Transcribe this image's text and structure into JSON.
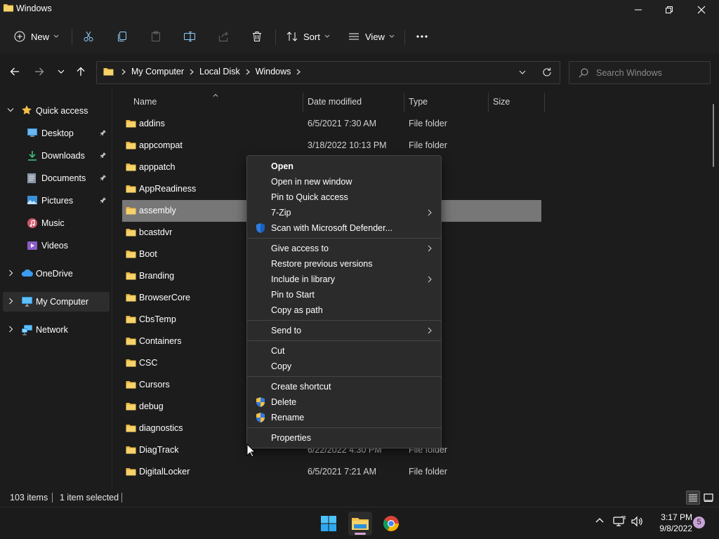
{
  "window": {
    "title": "Windows",
    "controls": [
      "minimize-icon",
      "restore-icon",
      "close-icon"
    ]
  },
  "commandbar": {
    "new_label": "New",
    "sort_label": "Sort",
    "view_label": "View",
    "icons": [
      "new-icon",
      "cut-icon",
      "copy-icon",
      "paste-icon",
      "rename-icon",
      "share-icon",
      "delete-icon",
      "sort-icon",
      "view-icon",
      "more-icon"
    ]
  },
  "address": {
    "breadcrumbs": [
      "My Computer",
      "Local Disk",
      "Windows"
    ],
    "search_placeholder": "Search Windows"
  },
  "sidebar": {
    "quick_access": "Quick access",
    "items": [
      {
        "label": "Desktop",
        "icon": "desktop-icon",
        "pinned": true
      },
      {
        "label": "Downloads",
        "icon": "downloads-icon",
        "pinned": true
      },
      {
        "label": "Documents",
        "icon": "documents-icon",
        "pinned": true
      },
      {
        "label": "Pictures",
        "icon": "pictures-icon",
        "pinned": true
      },
      {
        "label": "Music",
        "icon": "music-icon",
        "pinned": false
      },
      {
        "label": "Videos",
        "icon": "videos-icon",
        "pinned": false
      }
    ],
    "onedrive": "OneDrive",
    "my_computer": "My Computer",
    "network": "Network"
  },
  "columns": {
    "name": "Name",
    "date": "Date modified",
    "type": "Type",
    "size": "Size"
  },
  "files": [
    {
      "name": "addins",
      "date": "6/5/2021 7:30 AM",
      "type": "File folder",
      "selected": false
    },
    {
      "name": "appcompat",
      "date": "3/18/2022 10:13 PM",
      "type": "File folder",
      "selected": false
    },
    {
      "name": "apppatch",
      "date": "",
      "type": "",
      "selected": false
    },
    {
      "name": "AppReadiness",
      "date": "",
      "type": "",
      "selected": false
    },
    {
      "name": "assembly",
      "date": "",
      "type": "",
      "selected": true
    },
    {
      "name": "bcastdvr",
      "date": "",
      "type": "",
      "selected": false
    },
    {
      "name": "Boot",
      "date": "",
      "type": "",
      "selected": false
    },
    {
      "name": "Branding",
      "date": "",
      "type": "",
      "selected": false
    },
    {
      "name": "BrowserCore",
      "date": "",
      "type": "",
      "selected": false
    },
    {
      "name": "CbsTemp",
      "date": "",
      "type": "",
      "selected": false
    },
    {
      "name": "Containers",
      "date": "",
      "type": "",
      "selected": false
    },
    {
      "name": "CSC",
      "date": "",
      "type": "",
      "selected": false
    },
    {
      "name": "Cursors",
      "date": "",
      "type": "",
      "selected": false
    },
    {
      "name": "debug",
      "date": "",
      "type": "",
      "selected": false
    },
    {
      "name": "diagnostics",
      "date": "",
      "type": "",
      "selected": false
    },
    {
      "name": "DiagTrack",
      "date": "6/22/2022 4:30 PM",
      "type": "File folder",
      "selected": false
    },
    {
      "name": "DigitalLocker",
      "date": "6/5/2021 7:21 AM",
      "type": "File folder",
      "selected": false
    }
  ],
  "context_menu": {
    "groups": [
      [
        {
          "label": "Open",
          "bold": true,
          "icon": "",
          "submenu": false
        },
        {
          "label": "Open in new window",
          "bold": false,
          "icon": "",
          "submenu": false
        },
        {
          "label": "Pin to Quick access",
          "bold": false,
          "icon": "",
          "submenu": false
        },
        {
          "label": "7-Zip",
          "bold": false,
          "icon": "",
          "submenu": true
        },
        {
          "label": "Scan with Microsoft Defender...",
          "bold": false,
          "icon": "defender-shield-icon",
          "submenu": false
        }
      ],
      [
        {
          "label": "Give access to",
          "bold": false,
          "icon": "",
          "submenu": true
        },
        {
          "label": "Restore previous versions",
          "bold": false,
          "icon": "",
          "submenu": false
        },
        {
          "label": "Include in library",
          "bold": false,
          "icon": "",
          "submenu": true
        },
        {
          "label": "Pin to Start",
          "bold": false,
          "icon": "",
          "submenu": false
        },
        {
          "label": "Copy as path",
          "bold": false,
          "icon": "",
          "submenu": false
        }
      ],
      [
        {
          "label": "Send to",
          "bold": false,
          "icon": "",
          "submenu": true
        }
      ],
      [
        {
          "label": "Cut",
          "bold": false,
          "icon": "",
          "submenu": false
        },
        {
          "label": "Copy",
          "bold": false,
          "icon": "",
          "submenu": false
        }
      ],
      [
        {
          "label": "Create shortcut",
          "bold": false,
          "icon": "",
          "submenu": false
        },
        {
          "label": "Delete",
          "bold": false,
          "icon": "uac-shield-icon",
          "submenu": false
        },
        {
          "label": "Rename",
          "bold": false,
          "icon": "uac-shield-icon",
          "submenu": false
        }
      ],
      [
        {
          "label": "Properties",
          "bold": false,
          "icon": "",
          "submenu": false
        }
      ]
    ]
  },
  "status": {
    "items_count": "103 items",
    "selected_count": "1 item selected"
  },
  "taskbar": {
    "apps": [
      "start-icon",
      "file-explorer-icon",
      "chrome-icon"
    ],
    "time": "3:17 PM",
    "date": "9/8/2022",
    "notifications": "5"
  },
  "colors": {
    "background": "#1c1c1c",
    "chrome": "#202020",
    "selection": "#777777",
    "menu": "#2b2b2b",
    "folder": "#f2c04a",
    "accent": "#4cc2ff"
  }
}
